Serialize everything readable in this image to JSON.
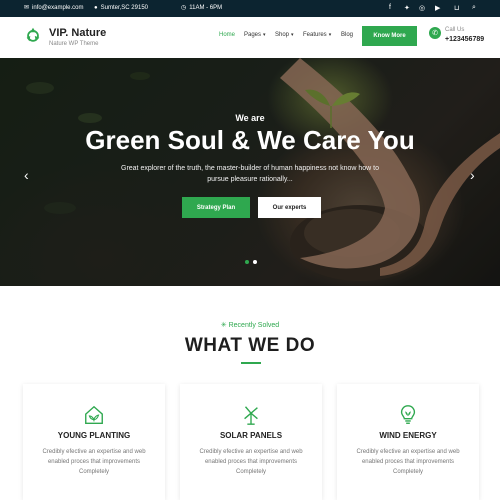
{
  "topbar": {
    "email": "info@example.com",
    "location": "Sumter,SC 29150",
    "hours": "11AM - 6PM",
    "social_icons": [
      "facebook-icon",
      "twitter-icon",
      "instagram-icon",
      "youtube-icon",
      "cart-icon",
      "search-icon"
    ]
  },
  "header": {
    "brand": "VIP. Nature",
    "tagline": "Nature WP Theme",
    "nav": [
      "Home",
      "Pages",
      "Shop",
      "Features",
      "Blog"
    ],
    "cta": "Know More",
    "call_label": "Call Us",
    "call_number": "+123456789"
  },
  "hero": {
    "subtitle": "We are",
    "title": "Green Soul & We Care You",
    "description": "Great explorer of the truth, the master-builder of human happiness not know how to pursue pleasure rationally...",
    "primary_button": "Strategy Plan",
    "secondary_button": "Our experts",
    "slides_total": 2,
    "slide_active": 1
  },
  "services": {
    "eyebrow": "Recently Solved",
    "title": "WHAT WE DO",
    "items": [
      {
        "title": "YOUNG PLANTING",
        "description": "Credibly efective an expertise and web enabled proces that improvements Completely",
        "icon": "greenhouse-icon"
      },
      {
        "title": "SOLAR PANELS",
        "description": "Credibly efective an expertise and web enabled proces that improvements Completely",
        "icon": "windmill-icon"
      },
      {
        "title": "WIND ENERGY",
        "description": "Credibly efective an expertise and web enabled proces that improvements Completely",
        "icon": "eco-bulb-icon"
      }
    ]
  },
  "colors": {
    "accent": "#2fa84f",
    "topbar": "#0c2430"
  }
}
